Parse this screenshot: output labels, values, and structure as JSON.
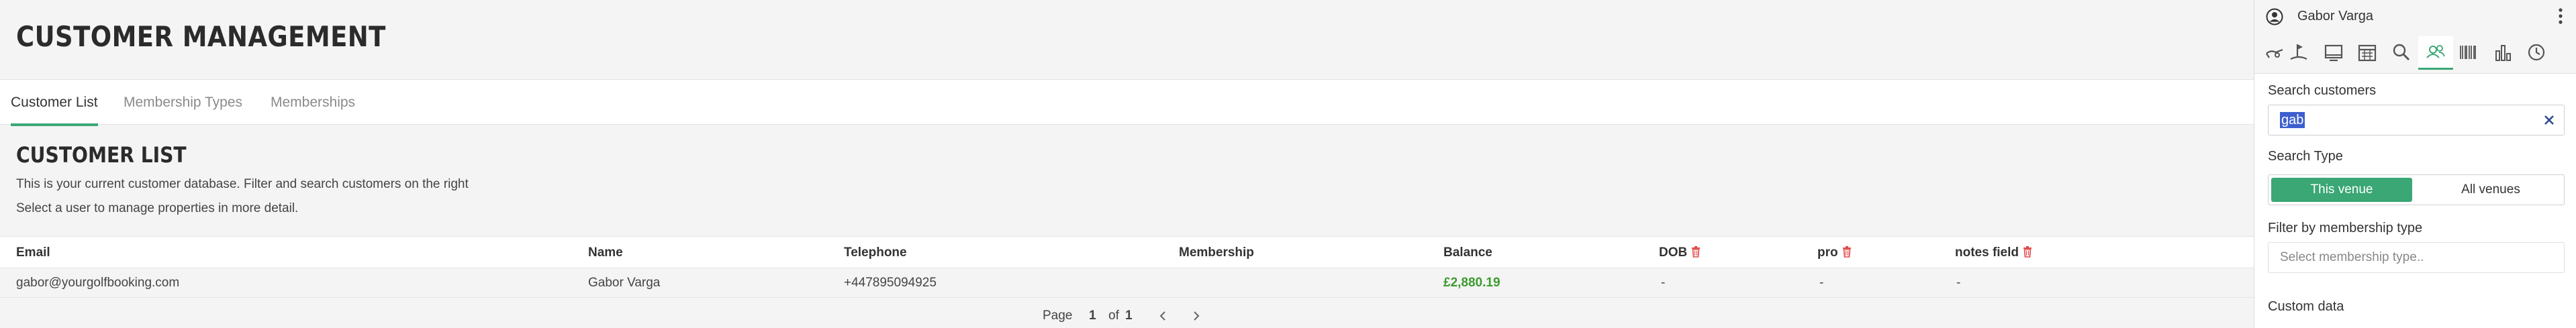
{
  "page": {
    "title": "CUSTOMER MANAGEMENT"
  },
  "tabs": [
    {
      "label": "Customer List",
      "active": true
    },
    {
      "label": "Membership Types",
      "active": false
    },
    {
      "label": "Memberships",
      "active": false
    }
  ],
  "section": {
    "title": "CUSTOMER LIST",
    "desc1": "This is your current customer database. Filter and search customers on the right",
    "desc2": "Select a user to manage properties in more detail."
  },
  "table": {
    "columns": [
      "Email",
      "Name",
      "Telephone",
      "Membership",
      "Balance",
      "DOB",
      "pro",
      "notes field"
    ],
    "rows": [
      {
        "email": "gabor@yourgolfbooking.com",
        "name": "Gabor Varga",
        "telephone": "+447895094925",
        "membership": "",
        "balance": "£2,880.19",
        "dob": "-",
        "pro": "-",
        "notes": "-"
      }
    ]
  },
  "pagination": {
    "page_label": "Page",
    "current": "1",
    "of_label": "of",
    "total": "1"
  },
  "panel": {
    "user_name": "Gabor Varga",
    "nav_icons": [
      "golf-swing-icon",
      "golf-flag-icon",
      "monitor-icon",
      "calendar-icon",
      "search-icon",
      "customers-icon",
      "barcode-icon",
      "bar-chart-icon",
      "clock-icon"
    ],
    "active_nav": "customers-icon",
    "search_label": "Search customers",
    "search_value": "gab",
    "search_type_label": "Search Type",
    "search_type_options": [
      "This venue",
      "All venues"
    ],
    "search_type_selected": "This venue",
    "membership_filter_label": "Filter by membership type",
    "membership_placeholder": "Select membership type..",
    "custom_data_label": "Custom data"
  },
  "colors": {
    "accent": "#3aa775",
    "balance": "#3c9b2f",
    "delete": "#e04848",
    "selection": "#3d5fcf"
  }
}
